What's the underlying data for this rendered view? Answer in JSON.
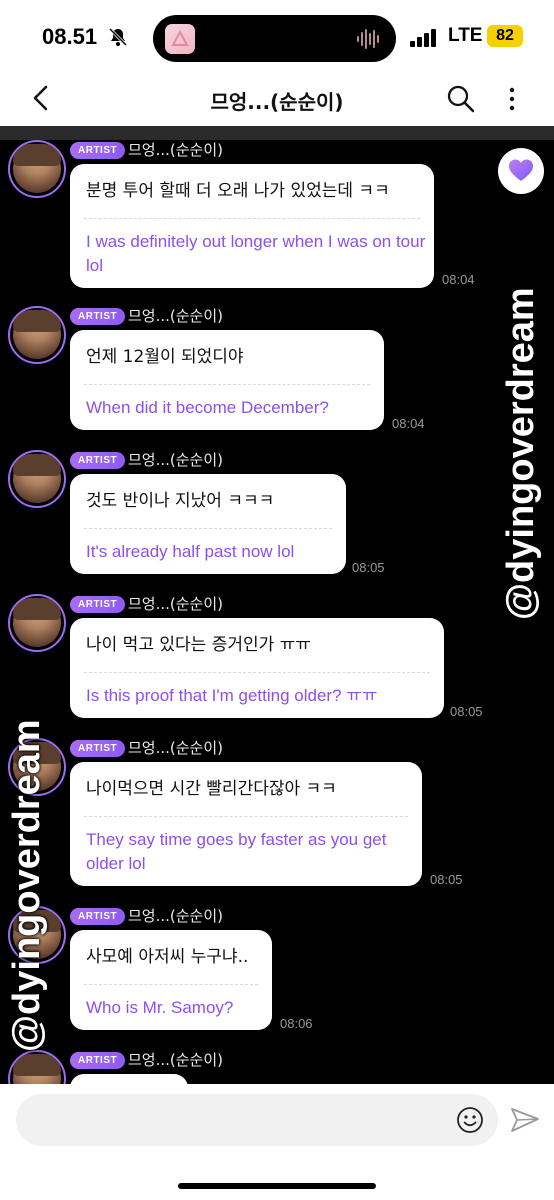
{
  "status_bar": {
    "time": "08.51",
    "network": "LTE",
    "battery": "82"
  },
  "header": {
    "title": "므엉...(순순이)"
  },
  "messages": [
    {
      "badge": "ARTIST",
      "sender": "므엉...(순순이)",
      "korean": "분명 투어 할때 더 오래 나가 있었는데 ㅋㅋ",
      "english": "I was definitely out longer when I was on tour lol",
      "time": "08:04"
    },
    {
      "badge": "ARTIST",
      "sender": "므엉...(순순이)",
      "korean": "언제 12월이 되었디야",
      "english": "When did it become December?",
      "time": "08:04"
    },
    {
      "badge": "ARTIST",
      "sender": "므엉...(순순이)",
      "korean": "것도 반이나 지났어 ㅋㅋㅋ",
      "english": "It's already half past now lol",
      "time": "08:05"
    },
    {
      "badge": "ARTIST",
      "sender": "므엉...(순순이)",
      "korean": "나이 먹고 있다는 증거인가 ㅠㅠ",
      "english": "Is this proof that I'm getting older? ㅠㅠ",
      "time": "08:05"
    },
    {
      "badge": "ARTIST",
      "sender": "므엉...(순순이)",
      "korean": "나이먹으면 시간 빨리간다잖아 ㅋㅋ",
      "english": "They say time goes by faster as you get older lol",
      "time": "08:05"
    },
    {
      "badge": "ARTIST",
      "sender": "므엉...(순순이)",
      "korean": "사모예 아저씨 누구냐..",
      "english": "Who is Mr. Samoy?",
      "time": "08:06"
    },
    {
      "badge": "ARTIST",
      "sender": "므엉...(순순이)"
    }
  ],
  "watermarks": {
    "right": "@dyingoverdream",
    "left": "@dyingoverdream"
  },
  "input": {
    "placeholder": ""
  },
  "icons": [
    "bell-off-icon",
    "signal-icon",
    "back-arrow-icon",
    "search-icon",
    "more-vertical-icon",
    "heart-icon",
    "emoji-icon",
    "send-icon"
  ],
  "colors": {
    "accent": "#8c4ff0",
    "badge": "#9b62f2",
    "background": "#000000"
  }
}
